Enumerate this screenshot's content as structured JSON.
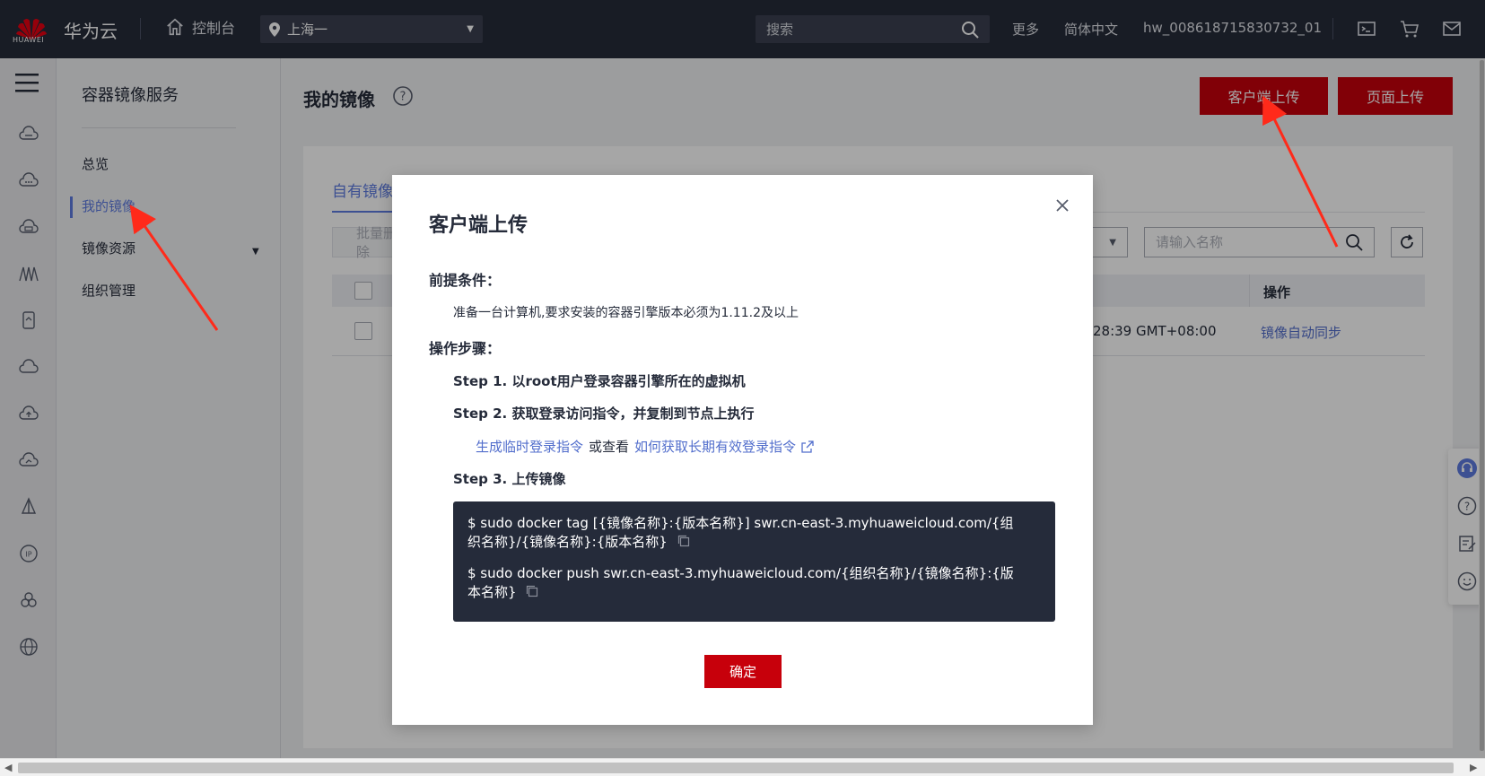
{
  "topbar": {
    "logo_text": "HUAWEI",
    "brand": "华为云",
    "console": "控制台",
    "region": "上海一",
    "search_placeholder": "搜索",
    "more": "更多",
    "language": "简体中文",
    "username": "hw_008618715830732_01"
  },
  "sidebar": {
    "title": "容器镜像服务",
    "items": [
      {
        "label": "总览"
      },
      {
        "label": "我的镜像"
      },
      {
        "label": "镜像资源"
      },
      {
        "label": "组织管理"
      }
    ]
  },
  "main": {
    "title": "我的镜像",
    "client_upload_button": "客户端上传",
    "page_upload_button": "页面上传",
    "tab_own": "自有镜像",
    "batch_button": "批量删除",
    "name_search_placeholder": "请输入名称",
    "table": {
      "op_header": "操作",
      "rows": [
        {
          "time_partial": "28:39 GMT+08:00",
          "action": "镜像自动同步"
        }
      ]
    }
  },
  "dialog": {
    "title": "客户端上传",
    "prereq_heading": "前提条件：",
    "prereq_text": "准备一台计算机,要求安装的容器引擎版本必须为1.11.2及以上",
    "steps_heading": "操作步骤：",
    "step1": "Step 1. 以root用户登录容器引擎所在的虚拟机",
    "step2": "Step 2. 获取登录访问指令，并复制到节点上执行",
    "link_temp": "生成临时登录指令",
    "link_or": "或查看",
    "link_long": "如何获取长期有效登录指令",
    "step3": "Step 3. 上传镜像",
    "code_line1": "$ sudo docker tag [{镜像名称}:{版本名称}] swr.cn-east-3.myhuaweicloud.com/{组织名称}/{镜像名称}:{版本名称}",
    "code_line2": "$ sudo docker push swr.cn-east-3.myhuaweicloud.com/{组织名称}/{镜像名称}:{版本名称}",
    "ok_button": "确定"
  },
  "colors": {
    "topbar_bg": "#252b3a",
    "brand_red": "#c7000b",
    "accent_blue": "#5e7ce0",
    "link_blue": "#526ecc",
    "annotation_arrow": "#ff2a1a"
  },
  "icons": [
    "home-icon",
    "location-pin-icon",
    "search-icon",
    "terminal-icon",
    "cart-icon",
    "mail-icon",
    "menu-icon",
    "help-icon",
    "refresh-icon",
    "close-icon",
    "copy-icon",
    "external-link-icon",
    "customer-service-icon",
    "question-icon",
    "feedback-icon",
    "smile-icon"
  ]
}
